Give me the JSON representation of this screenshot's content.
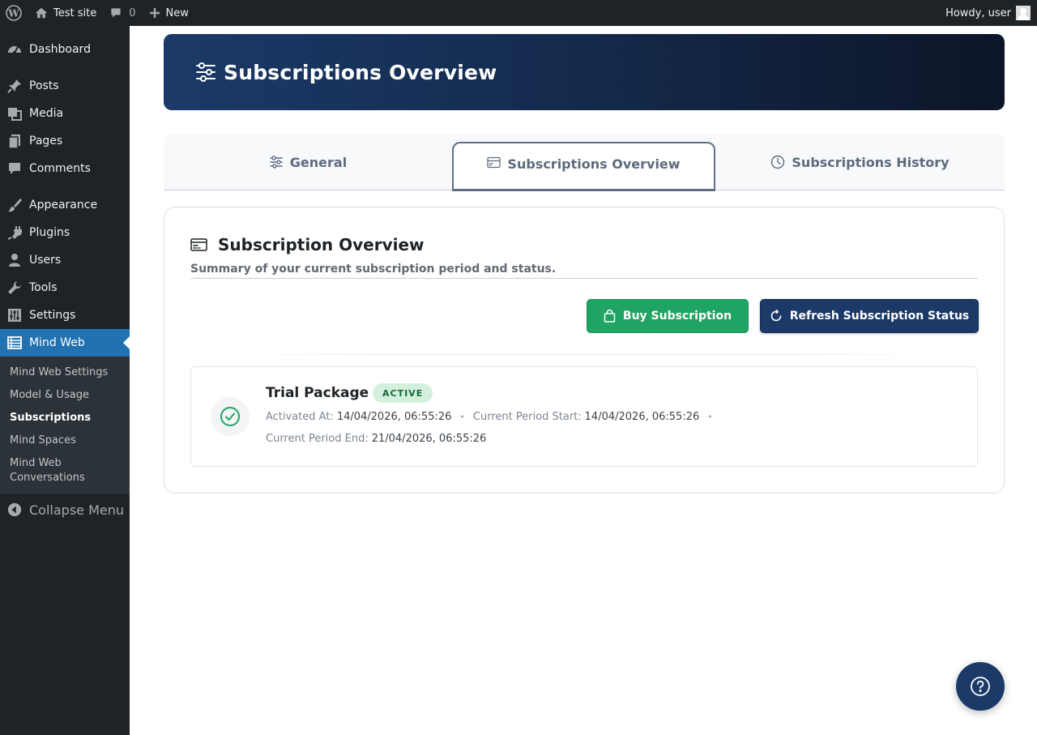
{
  "adminbar": {
    "site_name": "Test site",
    "comments_count": "0",
    "new_label": "New",
    "howdy": "Howdy, user"
  },
  "sidebar": {
    "items": [
      {
        "label": "Dashboard",
        "icon": "dashboard-icon"
      },
      {
        "label": "Posts",
        "icon": "pin-icon"
      },
      {
        "label": "Media",
        "icon": "media-icon"
      },
      {
        "label": "Pages",
        "icon": "pages-icon"
      },
      {
        "label": "Comments",
        "icon": "comment-icon"
      },
      {
        "label": "Appearance",
        "icon": "brush-icon"
      },
      {
        "label": "Plugins",
        "icon": "plug-icon"
      },
      {
        "label": "Users",
        "icon": "user-icon"
      },
      {
        "label": "Tools",
        "icon": "wrench-icon"
      },
      {
        "label": "Settings",
        "icon": "sliders-icon"
      },
      {
        "label": "Mind Web",
        "icon": "list-icon"
      }
    ],
    "submenu": [
      "Mind Web Settings",
      "Model & Usage",
      "Subscriptions",
      "Mind Spaces",
      "Mind Web Conversations"
    ],
    "current_submenu": "Subscriptions",
    "collapse_label": "Collapse Menu"
  },
  "banner": {
    "title": "Subscriptions Overview"
  },
  "tabs": [
    {
      "label": "General",
      "icon": "sliders-icon"
    },
    {
      "label": "Subscriptions Overview",
      "icon": "card-icon",
      "active": true
    },
    {
      "label": "Subscriptions History",
      "icon": "clock-icon"
    }
  ],
  "card": {
    "title": "Subscription Overview",
    "subtitle": "Summary of your current subscription period and status.",
    "buy_label": "Buy Subscription",
    "refresh_label": "Refresh Subscription Status"
  },
  "subscription": {
    "name": "Trial Package",
    "status": "ACTIVE",
    "activated_label": "Activated At:",
    "activated_value": "14/04/2026, 06:55:26",
    "period_start_label": "Current Period Start:",
    "period_start_value": "14/04/2026, 06:55:26",
    "period_end_label": "Current Period End:",
    "period_end_value": "21/04/2026, 06:55:26"
  },
  "colors": {
    "accent": "#2271b1",
    "navy": "#1b3a68",
    "green": "#1fa463",
    "adminbar": "#1d2327"
  }
}
